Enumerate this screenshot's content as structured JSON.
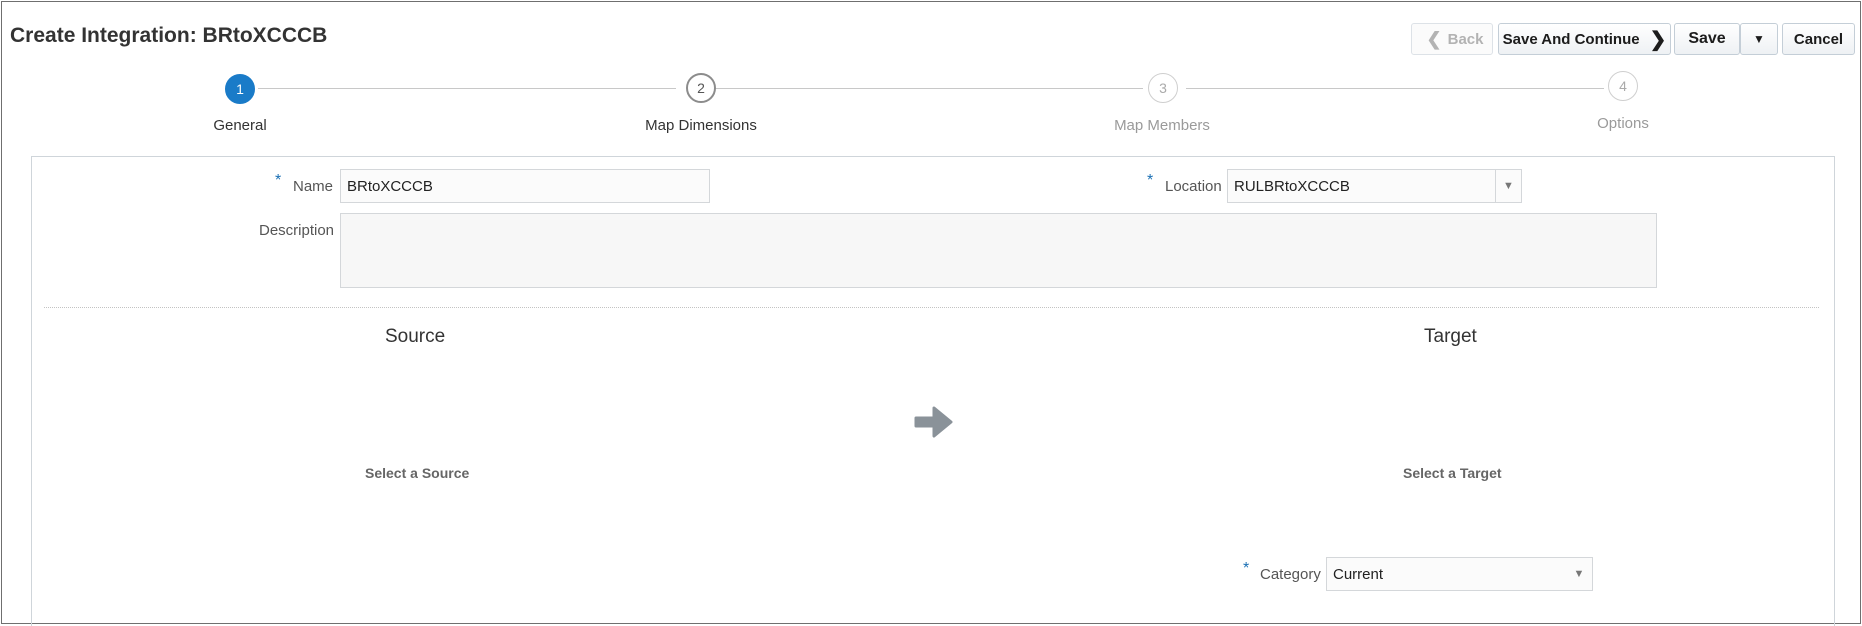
{
  "page": {
    "title": "Create Integration: BRtoXCCCB"
  },
  "toolbar": {
    "back_label": "Back",
    "save_continue_label": "Save And Continue",
    "save_label": "Save",
    "cancel_label": "Cancel",
    "back_icon": "chevron-left-icon",
    "continue_icon": "chevron-right-icon",
    "save_menu_icon": "caret-down-icon"
  },
  "train": {
    "steps": [
      {
        "number": "1",
        "label": "General",
        "state": "current"
      },
      {
        "number": "2",
        "label": "Map Dimensions",
        "state": "enabled"
      },
      {
        "number": "3",
        "label": "Map Members",
        "state": "disabled"
      },
      {
        "number": "4",
        "label": "Options",
        "state": "disabled"
      }
    ]
  },
  "form": {
    "required_mark": "*",
    "name": {
      "label": "Name",
      "value": "BRtoXCCCB"
    },
    "location": {
      "label": "Location",
      "value": "RULBRtoXCCCB"
    },
    "description": {
      "label": "Description",
      "value": ""
    },
    "category": {
      "label": "Category",
      "value": "Current"
    }
  },
  "source": {
    "heading": "Source",
    "hint": "Select a Source"
  },
  "target": {
    "heading": "Target",
    "hint": "Select a Target"
  },
  "colors": {
    "accent": "#1a7bc8",
    "required": "#1a6fb4",
    "arrow": "#8a9299"
  }
}
